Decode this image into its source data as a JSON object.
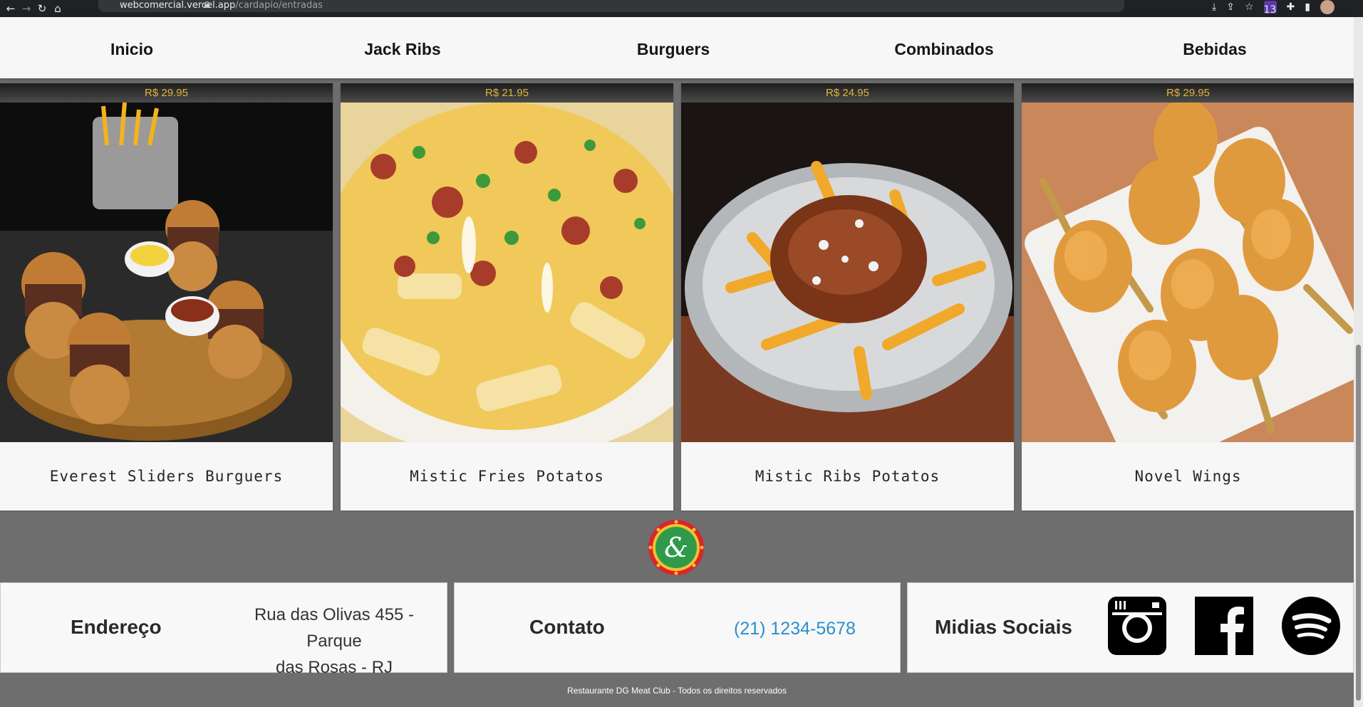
{
  "browser": {
    "url_host": "webcomercial.vercel.app",
    "url_path": "/cardapio/entradas",
    "extension_badge": "13"
  },
  "nav": {
    "items": [
      "Inicio",
      "Jack Ribs",
      "Burguers",
      "Combinados",
      "Bebidas"
    ]
  },
  "products": [
    {
      "price": "R$ 29.95",
      "name": "Everest Sliders Burguers"
    },
    {
      "price": "R$ 21.95",
      "name": "Mistic Fries Potatos"
    },
    {
      "price": "R$ 24.95",
      "name": "Mistic Ribs Potatos"
    },
    {
      "price": "R$ 29.95",
      "name": "Novel Wings"
    }
  ],
  "footer": {
    "address_label": "Endereço",
    "address_line1": "Rua das Olivas 455 - Parque",
    "address_line2": "das Rosas - RJ",
    "contact_label": "Contato",
    "phone": "(21) 1234-5678",
    "social_label": "Midias Sociais",
    "social_icons": [
      "instagram-icon",
      "facebook-icon",
      "spotify-icon"
    ],
    "logo_mark": "&",
    "copyright": "Restaurante DG Meat Club - Todos os direitos reservados"
  },
  "colors": {
    "price_text": "#e4b43a",
    "footer_bg": "#6e6e6e",
    "phone_link": "#2b8ed0",
    "logo_red": "#d8262c",
    "logo_green": "#2f9a4a"
  }
}
